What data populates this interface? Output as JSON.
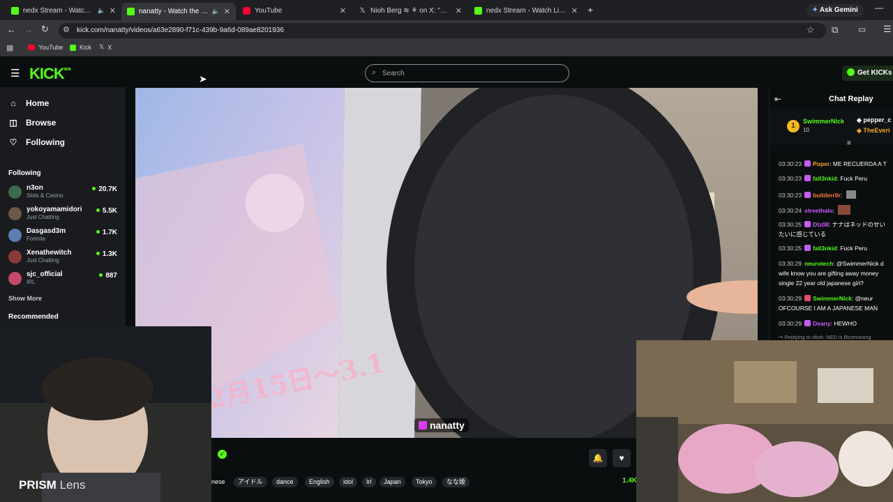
{
  "browser": {
    "tabs": [
      {
        "title": "nedx Stream - Watch Live o",
        "fav": "kick"
      },
      {
        "title": "nanatty - Watch the VOD o",
        "fav": "kick",
        "active": true
      },
      {
        "title": "YouTube",
        "fav": "youtube"
      },
      {
        "title": "Nioh Berg ≋ ⚘ on X: \"Mojtaba",
        "fav": "x"
      },
      {
        "title": "nedx Stream - Watch Live on Ki",
        "fav": "kick"
      }
    ],
    "new_tab": "+",
    "ask_gemini": "Ask Gemini",
    "url": "kick.com/nanatty/videos/a63e2890-f71c-439b-9a6d-089ae8201936",
    "bookmarks": [
      "YouTube",
      "Kick",
      "X"
    ]
  },
  "header": {
    "logo": "KICK",
    "logo_sup": "BETA",
    "search_placeholder": "Search",
    "get_kicks": "Get KICKs"
  },
  "sidebar": {
    "nav": [
      {
        "label": "Home",
        "icon": "home-icon"
      },
      {
        "label": "Browse",
        "icon": "compass-icon"
      },
      {
        "label": "Following",
        "icon": "heart-icon"
      }
    ],
    "following_heading": "Following",
    "following": [
      {
        "name": "n3on",
        "category": "Slots & Casino",
        "viewers": "20.7K",
        "color": "#3a6b4a"
      },
      {
        "name": "yokoyamamidori",
        "category": "Just Chatting",
        "viewers": "5.5K",
        "color": "#6b5a4a"
      },
      {
        "name": "Dasgasd3m",
        "category": "Fortnite",
        "viewers": "1.7K",
        "color": "#5a7fb0"
      },
      {
        "name": "Xenathewitch",
        "category": "Just Chatting",
        "viewers": "1.3K",
        "color": "#8a3a3a"
      },
      {
        "name": "sjc_official",
        "category": "IRL",
        "viewers": "887",
        "color": "#c44a6a"
      }
    ],
    "show_more": "Show More",
    "recommended_heading": "Recommended"
  },
  "video": {
    "watermark": "nanatty",
    "window_text": "2月15日～3.1"
  },
  "info": {
    "tags": [
      "nese",
      "アイドル",
      "dance",
      "English",
      "idol",
      "Irl",
      "Japan",
      "Tokyo",
      "なな姫"
    ],
    "viewers": "1.4K"
  },
  "chat": {
    "title": "Chat Replay",
    "gifters": [
      {
        "rank": "1",
        "name": "SwimmerNick",
        "count": "10"
      },
      {
        "name": "pepper_c"
      },
      {
        "name": "TheEveri"
      }
    ],
    "messages": [
      {
        "time": "03:30:23",
        "user": "Poper",
        "color": "#f5a623",
        "text": "ME RECUERDA A T"
      },
      {
        "time": "03:30:23",
        "user": "fall3nkid",
        "color": "#53fc18",
        "text": "Fuck Peru"
      },
      {
        "time": "03:30:23",
        "user": "builderr0r",
        "color": "#ff7a3d",
        "text": ""
      },
      {
        "time": "03:30:24",
        "user": "streethalo",
        "color": "#c75cf5",
        "text": ""
      },
      {
        "time": "03:30:25",
        "user": "Dtz08",
        "color": "#c75cf5",
        "text": "ナナはネッドのせい"
      },
      {
        "time": "",
        "user": "",
        "color": "#fff",
        "text": "たいに感じている"
      },
      {
        "time": "03:30:25",
        "user": "fall3nkid",
        "color": "#53fc18",
        "text": "Fuck Peru"
      },
      {
        "time": "03:30:29",
        "user": "neurotech",
        "color": "#53fc18",
        "text": "@SwimmerNick d"
      },
      {
        "time": "",
        "user": "",
        "color": "#fff",
        "text": "wife know you are gifting away money"
      },
      {
        "time": "",
        "user": "",
        "color": "#fff",
        "text": "single 22 year old japanese girl?"
      },
      {
        "time": "03:30:29",
        "user": "SwimmerNick",
        "color": "#53fc18",
        "text": "@neur"
      },
      {
        "time": "",
        "user": "",
        "color": "#fff",
        "text": "OFCOURSE I AM A JAPANESE MAN"
      },
      {
        "time": "03:30:29",
        "user": "Deany",
        "color": "#c75cf5",
        "text": "HEWHO"
      }
    ],
    "replying": "Replying to okok: NED is Ricemaxing"
  },
  "overlay": {
    "prism_bold": "PRISM",
    "prism_light": "Lens"
  }
}
